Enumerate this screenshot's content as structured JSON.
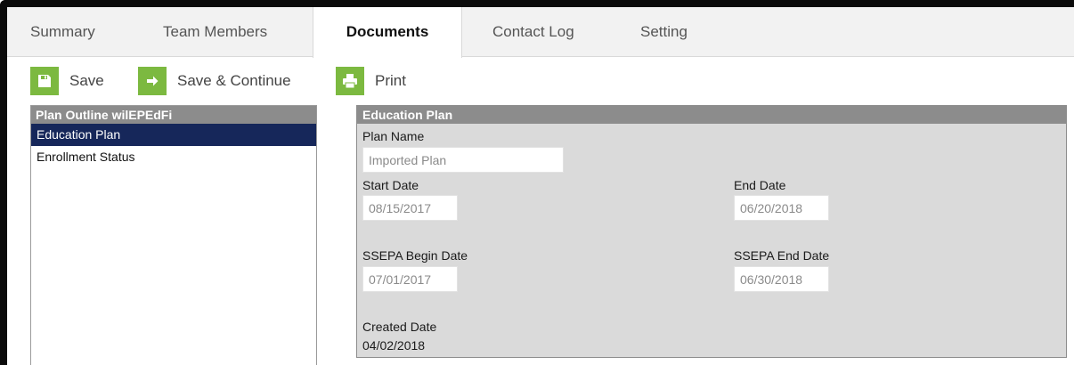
{
  "tabs": [
    {
      "label": "Summary"
    },
    {
      "label": "Team Members"
    },
    {
      "label": "Documents"
    },
    {
      "label": "Contact Log"
    },
    {
      "label": "Setting"
    }
  ],
  "active_tab": "Documents",
  "toolbar": {
    "save_label": "Save",
    "save_continue_label": "Save & Continue",
    "print_label": "Print",
    "save_icon": "floppy-disk-icon",
    "save_continue_icon": "arrow-right-icon",
    "print_icon": "printer-icon",
    "icon_color": "#7cb940"
  },
  "outline": {
    "title": "Plan Outline wilEPEdFi",
    "items": [
      {
        "label": "Education Plan",
        "selected": true
      },
      {
        "label": "Enrollment Status",
        "selected": false
      }
    ],
    "selected_color": "#16275a"
  },
  "plan": {
    "title": "Education Plan",
    "plan_name_label": "Plan Name",
    "plan_name_value": "Imported Plan",
    "start_date_label": "Start Date",
    "start_date_value": "08/15/2017",
    "end_date_label": "End Date",
    "end_date_value": "06/20/2018",
    "ssepa_begin_label": "SSEPA Begin Date",
    "ssepa_begin_value": "07/01/2017",
    "ssepa_end_label": "SSEPA End Date",
    "ssepa_end_value": "06/30/2018",
    "created_date_label": "Created Date",
    "created_date_value": "04/02/2018"
  }
}
